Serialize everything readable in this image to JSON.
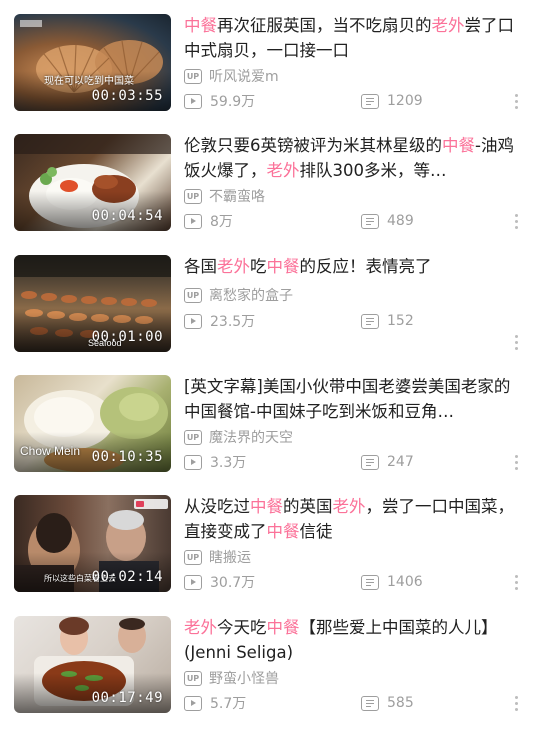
{
  "accent_color": "#fb7299",
  "items": [
    {
      "title_parts": [
        {
          "text": "中餐",
          "hl": true
        },
        {
          "text": "再次征服英国，当不吃扇贝的",
          "hl": false
        },
        {
          "text": "老外",
          "hl": true
        },
        {
          "text": "尝了口中式扇贝，一口接一口",
          "hl": false
        }
      ],
      "uploader": "听风说爱m",
      "views": "59.9万",
      "danmaku": "1209",
      "duration": "00:03:55",
      "overlay": "现在可以吃到中国菜"
    },
    {
      "title_parts": [
        {
          "text": "伦敦只要6英镑被评为米其林星级的",
          "hl": false
        },
        {
          "text": "中餐",
          "hl": true
        },
        {
          "text": "-油鸡饭火爆了，",
          "hl": false
        },
        {
          "text": "老外",
          "hl": true
        },
        {
          "text": "排队300多米，等…",
          "hl": false
        }
      ],
      "uploader": "不霸蛮咯",
      "views": "8万",
      "danmaku": "489",
      "duration": "00:04:54",
      "overlay": ""
    },
    {
      "title_parts": [
        {
          "text": "各国",
          "hl": false
        },
        {
          "text": "老外",
          "hl": true
        },
        {
          "text": "吃",
          "hl": false
        },
        {
          "text": "中餐",
          "hl": true
        },
        {
          "text": "的反应！表情亮了",
          "hl": false
        }
      ],
      "uploader": "离愁家的盒子",
      "views": "23.5万",
      "danmaku": "152",
      "duration": "00:01:00",
      "overlay": "Seafood"
    },
    {
      "title_parts": [
        {
          "text": "[英文字幕]美国小伙带中国老婆尝美国老家的中国餐馆-中国妹子吃到米饭和豆角…",
          "hl": false
        }
      ],
      "uploader": "魔法界的天空",
      "views": "3.3万",
      "danmaku": "247",
      "duration": "00:10:35",
      "overlay": "Chow Mein"
    },
    {
      "title_parts": [
        {
          "text": "从没吃过",
          "hl": false
        },
        {
          "text": "中餐",
          "hl": true
        },
        {
          "text": "的英国",
          "hl": false
        },
        {
          "text": "老外",
          "hl": true
        },
        {
          "text": "，尝了一口中国菜，直接变成了",
          "hl": false
        },
        {
          "text": "中餐",
          "hl": true
        },
        {
          "text": "信徒",
          "hl": false
        }
      ],
      "uploader": "瞎搬运",
      "views": "30.7万",
      "danmaku": "1406",
      "duration": "00:02:14",
      "overlay": "所以这些白菜看上去"
    },
    {
      "title_parts": [
        {
          "text": "老外",
          "hl": true
        },
        {
          "text": "今天吃",
          "hl": false
        },
        {
          "text": "中餐",
          "hl": true
        },
        {
          "text": "【那些爱上中国菜的人儿】(Jenni Seliga)",
          "hl": false
        }
      ],
      "uploader": "野蛮小怪兽",
      "views": "5.7万",
      "danmaku": "585",
      "duration": "00:17:49",
      "overlay": ""
    }
  ]
}
